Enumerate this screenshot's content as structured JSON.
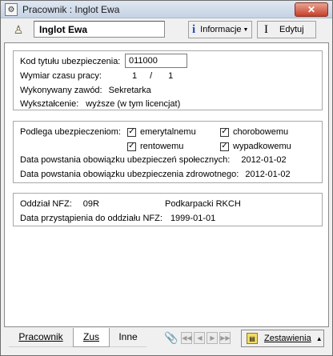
{
  "window": {
    "title": "Pracownik : Inglot Ewa",
    "close_label": "✕"
  },
  "toolbar": {
    "name": "Inglot Ewa",
    "info_label": "Informacje",
    "edit_label": "Edytuj"
  },
  "panel1": {
    "kod_label": "Kod tytułu ubezpieczenia:",
    "kod_value": "011000",
    "wymiar_label": "Wymiar czasu pracy:",
    "wymiar_num": "1",
    "wymiar_sep": "/",
    "wymiar_den": "1",
    "zawod_label": "Wykonywany zawód:",
    "zawod_value": "Sekretarka",
    "wyksztalcenie_label": "Wykształcenie:",
    "wyksztalcenie_value": "wyższe (w tym licencjat)"
  },
  "panel2": {
    "podlega_label": "Podlega ubezpieczeniom:",
    "checkboxes": [
      {
        "label": "emerytalnemu",
        "checked": true
      },
      {
        "label": "chorobowemu",
        "checked": true
      },
      {
        "label": "rentowemu",
        "checked": true
      },
      {
        "label": "wypadkowemu",
        "checked": true
      }
    ],
    "data_spol_label": "Data powstania obowiązku ubezpieczeń społecznych:",
    "data_spol_value": "2012-01-02",
    "data_zdr_label": "Data powstania obowiązku ubezpieczenia zdrowotnego:",
    "data_zdr_value": "2012-01-02"
  },
  "panel3": {
    "oddzial_label": "Oddział NFZ:",
    "oddzial_code": "09R",
    "oddzial_name": "Podkarpacki RKCH",
    "data_przyst_label": "Data przystąpienia do oddziału NFZ:",
    "data_przyst_value": "1999-01-01"
  },
  "tabs": [
    {
      "label": "Pracownik",
      "active": false
    },
    {
      "label": "Zus",
      "active": true
    },
    {
      "label": "Inne",
      "active": false
    }
  ],
  "nav": {
    "first": "◀◀",
    "prev": "◀",
    "next": "▶",
    "last": "▶▶"
  },
  "zestawienia_label": "Zestawienia"
}
